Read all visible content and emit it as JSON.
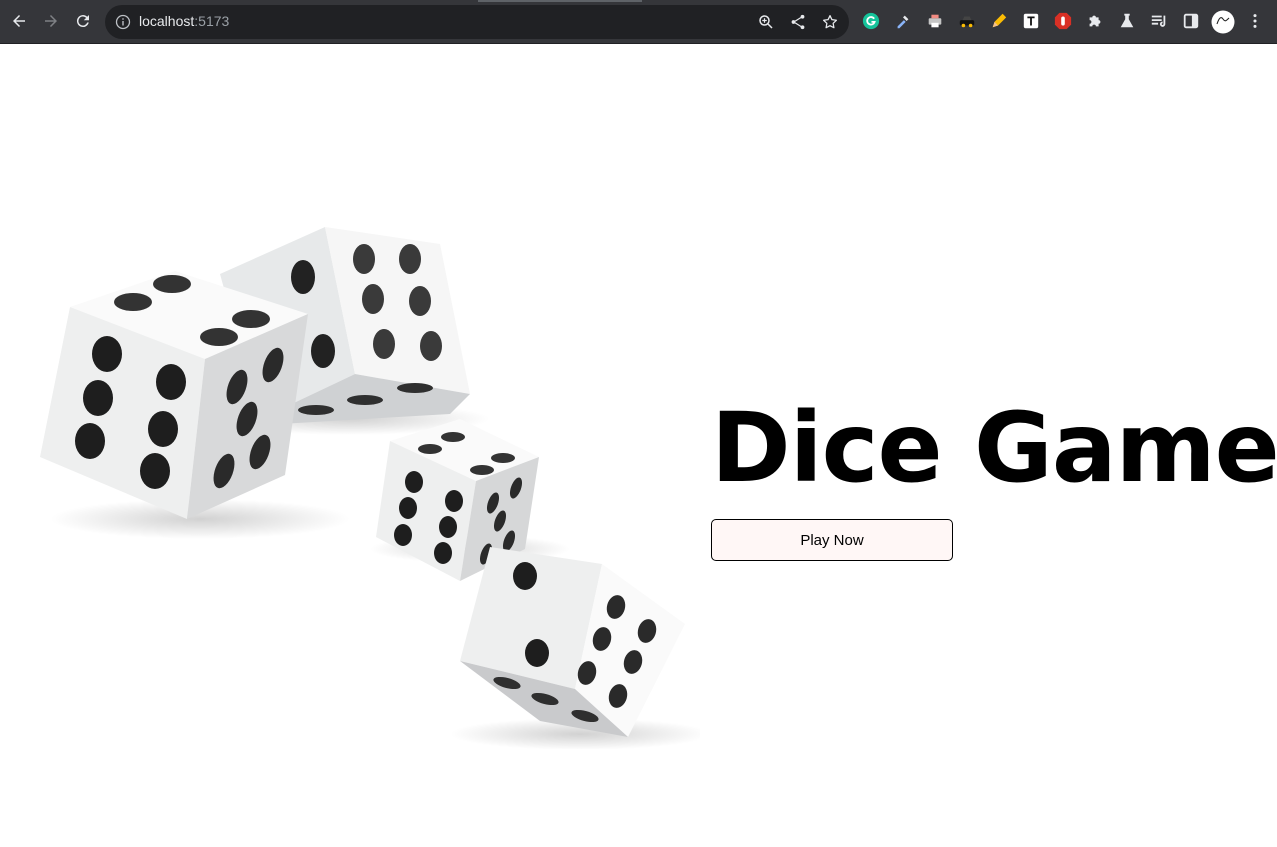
{
  "browser": {
    "url_host": "localhost",
    "url_port": ":5173",
    "extensions": [
      "grammarly-icon",
      "color-picker-icon",
      "printer-icon",
      "car-icon",
      "pencil-icon",
      "text-tool-icon",
      "stop-hand-icon",
      "puzzle-icon",
      "flask-icon",
      "reading-list-icon",
      "side-panel-icon",
      "profile-avatar",
      "menu-icon"
    ]
  },
  "hero": {
    "title": "Dice Game",
    "play_label": "Play Now"
  }
}
